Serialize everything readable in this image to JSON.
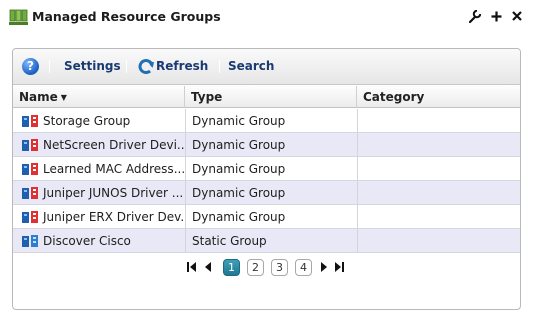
{
  "portlet": {
    "title": "Managed Resource Groups",
    "controls": [
      {
        "name": "wrench-icon",
        "glyph": "⚒"
      },
      {
        "name": "plus-icon",
        "glyph": "+"
      },
      {
        "name": "close-icon",
        "glyph": "✕"
      }
    ]
  },
  "toolbar": {
    "help_glyph": "?",
    "settings_label": "Settings",
    "refresh_label": "Refresh",
    "search_label": "Search"
  },
  "columns": {
    "name": "Name",
    "type": "Type",
    "category": "Category"
  },
  "rows": [
    {
      "name": "Storage Group",
      "type": "Dynamic Group",
      "category": "",
      "icon": "dynamic-group-icon"
    },
    {
      "name": "NetScreen Driver Devi...",
      "type": "Dynamic Group",
      "category": "",
      "icon": "dynamic-group-icon"
    },
    {
      "name": "Learned MAC Address...",
      "type": "Dynamic Group",
      "category": "",
      "icon": "dynamic-group-icon"
    },
    {
      "name": "Juniper JUNOS Driver ...",
      "type": "Dynamic Group",
      "category": "",
      "icon": "dynamic-group-icon"
    },
    {
      "name": "Juniper ERX Driver Dev...",
      "type": "Dynamic Group",
      "category": "",
      "icon": "dynamic-group-icon"
    },
    {
      "name": "Discover Cisco",
      "type": "Static Group",
      "category": "",
      "icon": "static-group-icon"
    }
  ],
  "pager": {
    "pages": [
      "1",
      "2",
      "3",
      "4"
    ],
    "current": "1"
  },
  "colors": {
    "alt_row": "#e8e8f6",
    "active_page": "#2a8aa4",
    "toolbar_text": "#1a3a73"
  }
}
